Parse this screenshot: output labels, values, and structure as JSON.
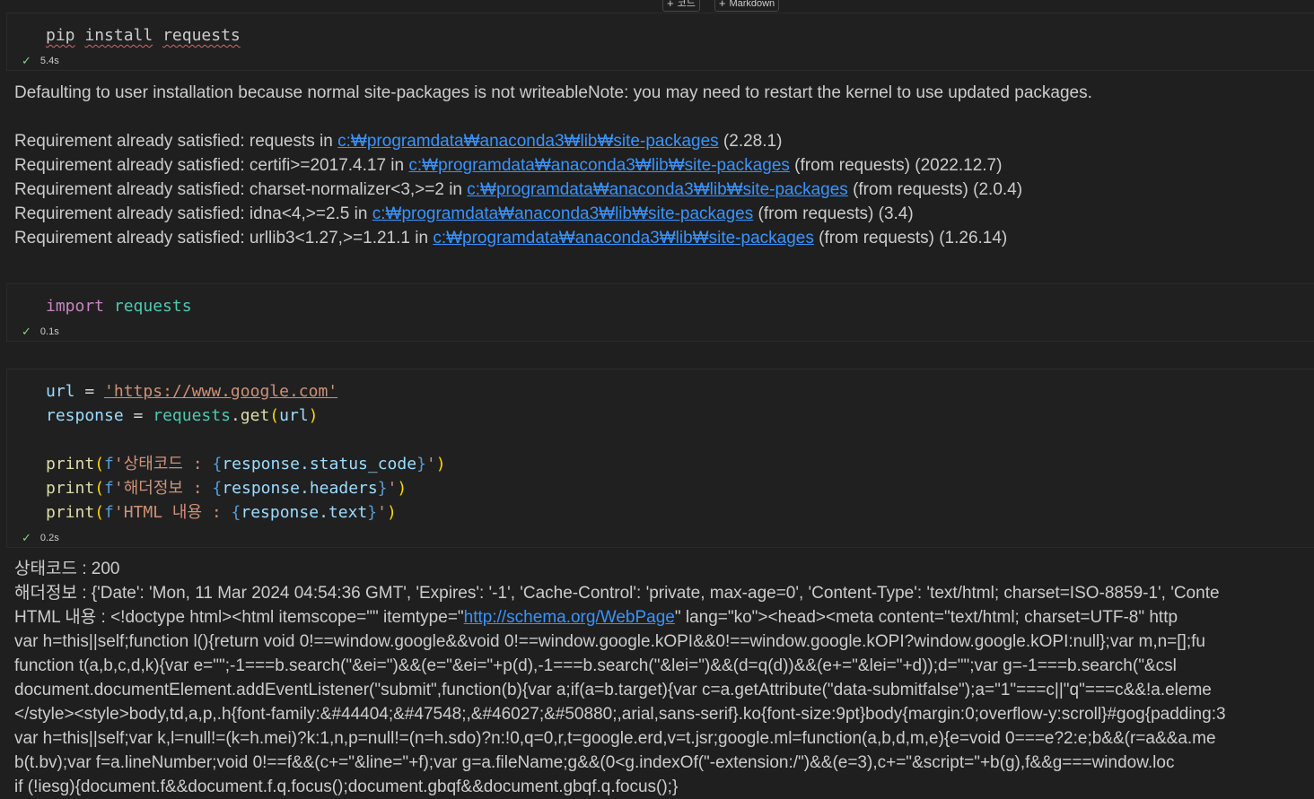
{
  "toolbar": {
    "add_code_label": "코드",
    "add_markdown_label": "Markdown"
  },
  "cells": [
    {
      "id": "cell1",
      "code": {
        "pip": "pip",
        "install": "install",
        "pkg": "requests"
      },
      "exec_time": "5.4s"
    },
    {
      "id": "cell2",
      "code": {
        "import_kw": "import",
        "module": "requests"
      },
      "exec_time": "0.1s"
    },
    {
      "id": "cell3",
      "code": {
        "url_var": "url",
        "url_value": "'https://www.google.com'",
        "response_var": "response",
        "requests_mod": "requests",
        "get_fn": "get",
        "url_arg": "url",
        "print_fn": "print",
        "f_prefix": "f",
        "status_prefix": "'상태코드 : ",
        "status_expr": "response.status_code",
        "headers_prefix": "'해더정보 : ",
        "headers_expr": "response.headers",
        "text_prefix": "'HTML 내용 : ",
        "text_expr": "response.text",
        "quote_end": "'"
      },
      "exec_time": "0.2s"
    }
  ],
  "output1": {
    "line1": "Defaulting to user installation because normal site-packages is not writeableNote: you may need to restart the kernel to use updated packages.",
    "path": "c:₩programdata₩anaconda3₩lib₩site-packages",
    "requirements": [
      {
        "prefix": "Requirement already satisfied: requests in ",
        "suffix": " (2.28.1)"
      },
      {
        "prefix": "Requirement already satisfied: certifi>=2017.4.17 in ",
        "suffix": " (from requests) (2022.12.7)"
      },
      {
        "prefix": "Requirement already satisfied: charset-normalizer<3,>=2 in ",
        "suffix": " (from requests) (2.0.4)"
      },
      {
        "prefix": "Requirement already satisfied: idna<4,>=2.5 in ",
        "suffix": " (from requests) (3.4)"
      },
      {
        "prefix": "Requirement already satisfied: urllib3<1.27,>=1.21.1 in ",
        "suffix": " (from requests) (1.26.14)"
      }
    ]
  },
  "output3": {
    "status_line": "상태코드 : 200",
    "headers_line": "해더정보 : {'Date': 'Mon, 11 Mar 2024 04:54:36 GMT', 'Expires': '-1', 'Cache-Control': 'private, max-age=0', 'Content-Type': 'text/html; charset=ISO-8859-1', 'Conte",
    "html_prefix": "HTML 내용 : <!doctype html><html itemscope=\"\" itemtype=\"",
    "html_link": "http://schema.org/WebPage",
    "html_suffix": "\" lang=\"ko\"><head><meta content=\"text/html; charset=UTF-8\" http",
    "lines": [
      "var h=this||self;function l(){return void 0!==window.google&&void 0!==window.google.kOPI&&0!==window.google.kOPI?window.google.kOPI:null};var m,n=[];fu",
      "function t(a,b,c,d,k){var e=\"\";-1===b.search(\"&ei=\")&&(e=\"&ei=\"+p(d),-1===b.search(\"&lei=\")&&(d=q(d))&&(e+=\"&lei=\"+d));d=\"\";var g=-1===b.search(\"&csl",
      "document.documentElement.addEventListener(\"submit\",function(b){var a;if(a=b.target){var c=a.getAttribute(\"data-submitfalse\");a=\"1\"===c||\"q\"===c&&!a.eleme",
      "</style><style>body,td,a,p,.h{font-family:&#44404;&#47548;,&#46027;&#50880;,arial,sans-serif}.ko{font-size:9pt}body{margin:0;overflow-y:scroll}#gog{padding:3",
      "var h=this||self;var k,l=null!=(k=h.mei)?k:1,n,p=null!=(n=h.sdo)?n:!0,q=0,r,t=google.erd,v=t.jsr;google.ml=function(a,b,d,m,e){e=void 0===e?2:e;b&&(r=a&&a.me",
      "b(t.bv);var f=a.lineNumber;void 0!==f&&(c+=\"&line=\"+f);var g=a.fileName;g&&(0<g.indexOf(\"-extension:/\")&&(e=3),c+=\"&script=\"+b(g),f&&g===window.loc",
      "if (!iesg){document.f&&document.f.q.focus();document.gbqf&&document.gbqf.q.focus();}"
    ]
  }
}
